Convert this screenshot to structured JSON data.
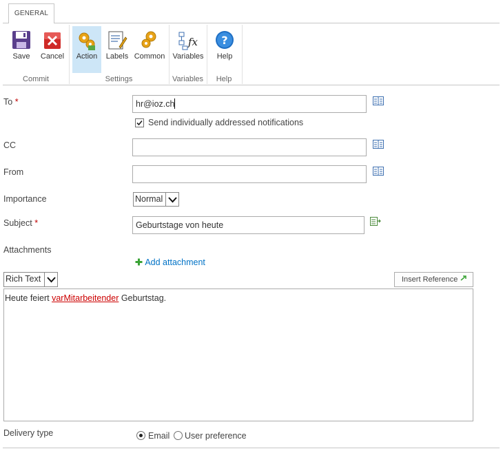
{
  "ribbon": {
    "tab": "GENERAL",
    "groups": {
      "commit": "Commit",
      "settings": "Settings",
      "variables": "Variables",
      "help": "Help"
    },
    "buttons": {
      "save": "Save",
      "cancel": "Cancel",
      "action": "Action",
      "labels": "Labels",
      "common": "Common",
      "variables": "Variables",
      "help": "Help"
    }
  },
  "form": {
    "to": {
      "label": "To",
      "required": "*",
      "value": "hr@ioz.ch"
    },
    "individual": {
      "label": "Send individually addressed notifications",
      "checked": true
    },
    "cc": {
      "label": "CC",
      "value": ""
    },
    "from": {
      "label": "From",
      "value": ""
    },
    "importance": {
      "label": "Importance",
      "selected": "Normal"
    },
    "subject": {
      "label": "Subject",
      "required": "*",
      "value": "Geburtstage von heute"
    },
    "attachments": {
      "label": "Attachments",
      "add_link": "Add attachment"
    },
    "body": {
      "format": "Rich Text",
      "insert_reference": "Insert Reference",
      "text_before": "Heute feiert ",
      "variable": "varMitarbeitender",
      "text_after": " Geburtstag."
    },
    "delivery": {
      "label": "Delivery type",
      "options": [
        "Email",
        "User preference"
      ],
      "selected": "Email"
    }
  },
  "colors": {
    "accent": "#0072c6",
    "active_button": "#cde6f7",
    "required": "#bf0000"
  }
}
